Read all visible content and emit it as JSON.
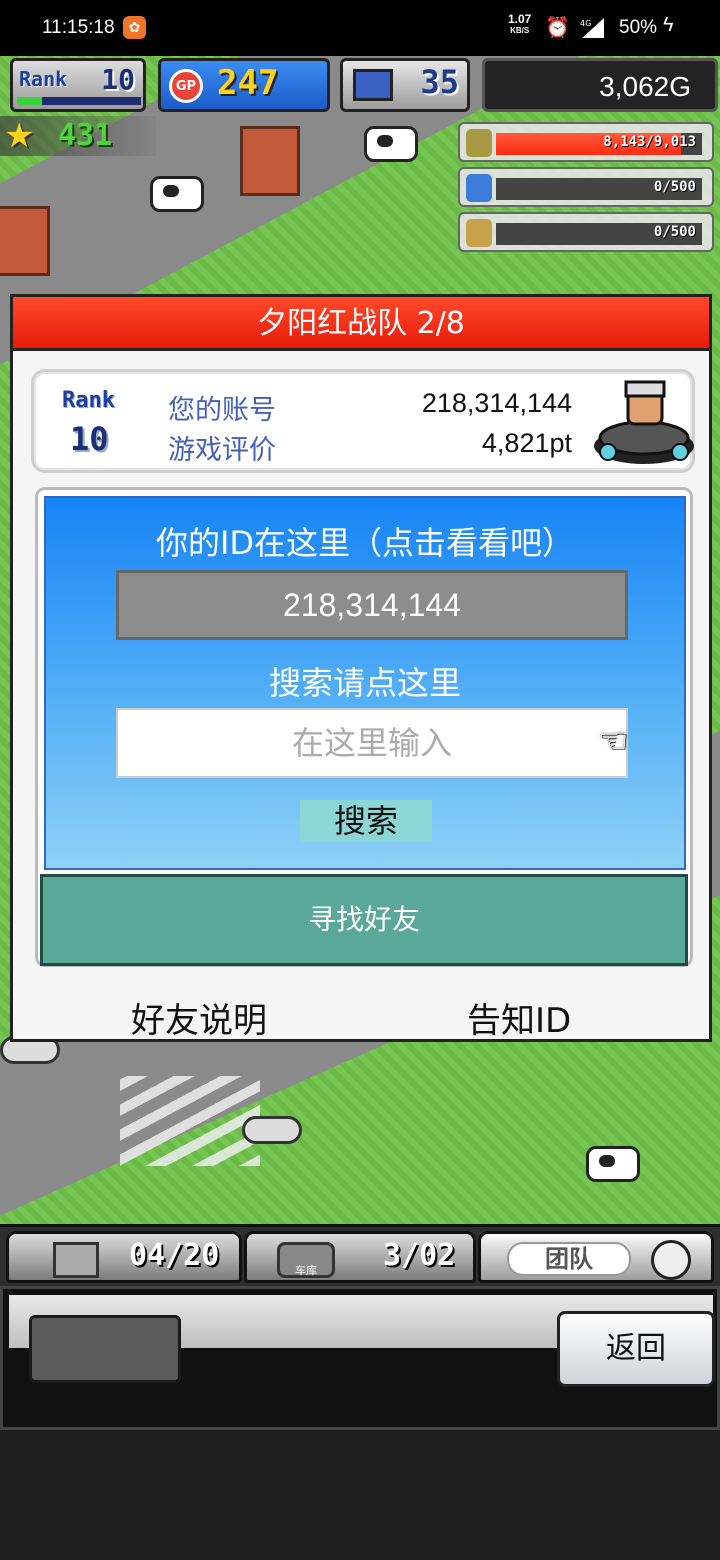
{
  "status_bar": {
    "time": "11:15:18",
    "net_speed": "1.07",
    "net_unit": "KB/S",
    "network_type": "4G",
    "battery": "50%"
  },
  "hud": {
    "rank_label": "Rank",
    "rank_value": "10",
    "rank_progress": 0.2,
    "gp_value": "247",
    "pc_value": "35",
    "gold": "3,062G",
    "stars": "431",
    "resources": [
      {
        "icon": "coin-stack-icon",
        "text": "8,143/9,013",
        "fill": 0.9
      },
      {
        "icon": "fuel-bottle-icon",
        "text": "0/500",
        "fill": 0
      },
      {
        "icon": "wheat-icon",
        "text": "0/500",
        "fill": 0
      }
    ]
  },
  "dialog": {
    "title": "夕阳红战队 2/8",
    "account": {
      "rank_label": "Rank",
      "rank_value": "10",
      "label_account": "您的账号",
      "value_account": "218,314,144",
      "label_rating": "游戏评价",
      "value_rating": "4,821pt"
    },
    "id_heading": "你的ID在这里（点击看看吧）",
    "id_value": "218,314,144",
    "search_heading": "搜索请点这里",
    "search_placeholder": "在这里输入",
    "search_button": "搜索",
    "find_friends": "寻找好友",
    "friend_help": "好友说明",
    "share_id": "告知ID"
  },
  "bottom_tabs": {
    "items_count": "04/20",
    "garage_label": "车库",
    "garage_count": "3/02",
    "team_label": "团队"
  },
  "menu": {
    "back_button": "返回"
  }
}
